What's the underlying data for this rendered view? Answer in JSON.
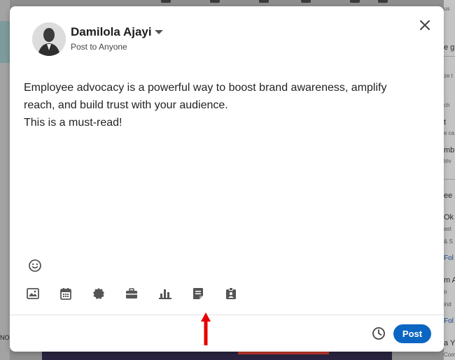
{
  "author": {
    "name": "Damilola Ajayi",
    "audience": "Post to Anyone"
  },
  "post": {
    "lines": [
      "Employee advocacy is a powerful way to boost brand awareness, amplify",
      "reach, and build trust with your audience.",
      "This is a must-read!"
    ]
  },
  "toolbar": {
    "icons": [
      "image-icon",
      "calendar-icon",
      "badge-icon",
      "briefcase-icon",
      "bar-chart-icon",
      "document-icon",
      "id-badge-icon"
    ]
  },
  "footer": {
    "post_label": "Post"
  },
  "colors": {
    "accent": "#0a66c2",
    "annotation_arrow": "#e60000"
  },
  "background_fragments": {
    "right": [
      "us",
      "e g",
      "ze t",
      "ch",
      "t",
      "e ca",
      "mb",
      "triv",
      "ee",
      "Ok",
      "ast",
      "& S",
      "Fol",
      "m A",
      "o",
      "ind",
      "Fol",
      "a Y",
      "Company"
    ],
    "left_bottom": "NO"
  }
}
